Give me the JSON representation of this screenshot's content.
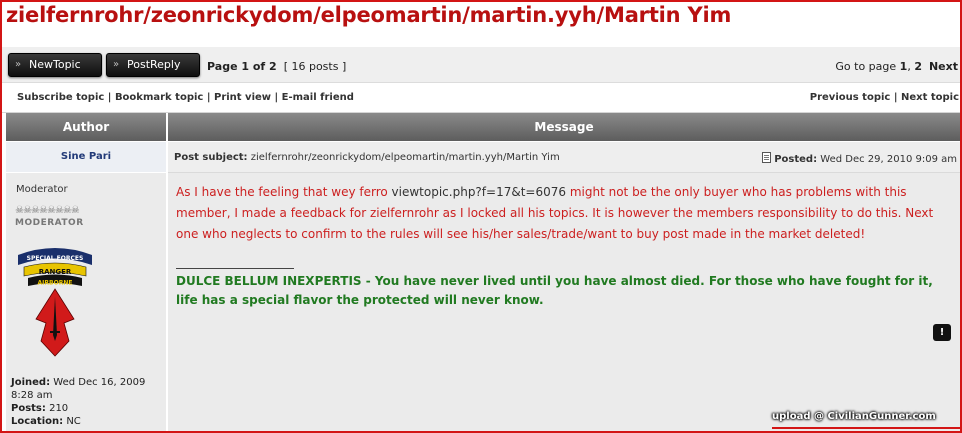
{
  "topic_title": "zielfernrohr/zeonrickydom/elpeomartin/martin.yyh/Martin Yim",
  "toolbar": {
    "new_topic_label": "NewTopic",
    "post_reply_label": "PostReply",
    "page_prefix": "Page ",
    "page_current": "1",
    "page_of": " of ",
    "page_total": "2",
    "posts_count": "[ 16 posts ]",
    "goto_prefix": "Go to page ",
    "goto_page1": "1",
    "goto_sep": ", ",
    "goto_page2": "2",
    "goto_next": "Next"
  },
  "topic_links": {
    "subscribe": "Subscribe topic",
    "bookmark": "Bookmark topic",
    "print": "Print view",
    "email": "E-mail friend",
    "previous": "Previous topic",
    "next": "Next topic",
    "sep": " | "
  },
  "table_headers": {
    "author": "Author",
    "message": "Message"
  },
  "post": {
    "author": "Sine Pari",
    "subject_label": "Post subject:",
    "subject": "zielfernrohr/zeonrickydom/elpeomartin/martin.yyh/Martin Yim",
    "posted_label": "Posted:",
    "posted_date": "Wed Dec 29, 2010 9:09 am",
    "rank": "Moderator",
    "rank_skulls": "☠☠☠☠☠☠☠☠",
    "rank_image_text": "MODERATOR",
    "insignia": {
      "tab_top": "SPECIAL FORCES",
      "tab_mid": "RANGER",
      "tab_low": "AIRBORNE"
    },
    "joined_label": "Joined:",
    "joined_value": "Wed Dec 16, 2009 8:28 am",
    "posts_label": "Posts:",
    "posts_value": "210",
    "location_label": "Location:",
    "location_value": "NC",
    "message_part1": "As I have the feeling that wey ferro ",
    "message_url": "viewtopic.php?f=17&t=6076",
    "message_part2": " might not be the only buyer who has problems with this member, I made a feedback for zielfernrohr as I locked all his topics. It is however the members responsibility to do this. Next one who neglects to confirm to the rules will see his/her sales/trade/want to buy post made in the market deleted!",
    "signature": "DULCE BELLUM INEXPERTIS - You have never lived until you have almost died. For those who have fought for it, life has a special flavor the protected will never know.",
    "report_label": "!"
  },
  "watermark": "upload @ CivilianGunner.com",
  "colors": {
    "title_red": "#b81010",
    "frame_red": "#d31515",
    "message_red": "#cc1f1f",
    "signature_green": "#217a21",
    "header_gray": "#6e6e6e"
  }
}
